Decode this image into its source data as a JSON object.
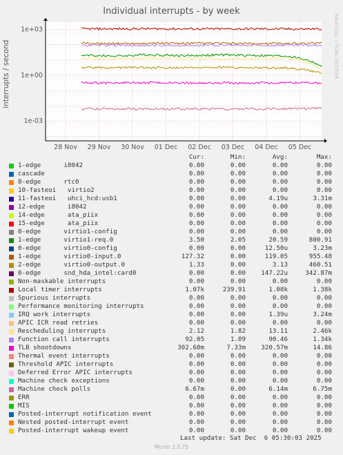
{
  "title": "Individual interrupts - by week",
  "side_brand": "RRDTOOL / TOBI OETIKER",
  "ylabel": "interrupts / second",
  "columns": {
    "cur": "Cur:",
    "min": "Min:",
    "avg": "Avg:",
    "max": "Max:"
  },
  "legend": [
    {
      "name": "1-edge      i8042",
      "color": "#00cc00",
      "cur": "0.00",
      "min": "0.00",
      "avg": "0.00",
      "max": "0.00"
    },
    {
      "name": "cascade",
      "color": "#0066b3",
      "cur": "0.00",
      "min": "0.00",
      "avg": "0.00",
      "max": "0.00"
    },
    {
      "name": "8-edge      rtc0",
      "color": "#ff8000",
      "cur": "0.00",
      "min": "0.00",
      "avg": "0.00",
      "max": "0.00"
    },
    {
      "name": "10-fasteoi   virtio2",
      "color": "#ffcc00",
      "cur": "0.00",
      "min": "0.00",
      "avg": "0.00",
      "max": "0.00"
    },
    {
      "name": "11-fasteoi   uhci_hcd:usb1",
      "color": "#330099",
      "cur": "0.00",
      "min": "0.00",
      "avg": "4.19u",
      "max": "3.31m"
    },
    {
      "name": "12-edge      i8042",
      "color": "#990099",
      "cur": "0.00",
      "min": "0.00",
      "avg": "0.00",
      "max": "0.00"
    },
    {
      "name": "14-edge      ata_piix",
      "color": "#ccff00",
      "cur": "0.00",
      "min": "0.00",
      "avg": "0.00",
      "max": "0.00"
    },
    {
      "name": "15-edge      ata_piix",
      "color": "#ff0000",
      "cur": "0.00",
      "min": "0.00",
      "avg": "0.00",
      "max": "0.00"
    },
    {
      "name": "0-edge      virtio1-config",
      "color": "#808080",
      "cur": "0.00",
      "min": "0.00",
      "avg": "0.00",
      "max": "0.00"
    },
    {
      "name": "1-edge      virtio1-req.0",
      "color": "#008f00",
      "cur": "3.50",
      "min": "2.05",
      "avg": "20.59",
      "max": "800.91"
    },
    {
      "name": "0-edge      virtio0-config",
      "color": "#00487d",
      "cur": "0.00",
      "min": "0.00",
      "avg": "12.50u",
      "max": "3.23m"
    },
    {
      "name": "1-edge      virtio0-input.0",
      "color": "#b35a00",
      "cur": "127.32",
      "min": "0.00",
      "avg": "119.05",
      "max": "955.48"
    },
    {
      "name": "2-edge      virtio0-output.0",
      "color": "#b38f00",
      "cur": "1.33",
      "min": "0.00",
      "avg": "3.13",
      "max": "460.51"
    },
    {
      "name": "0-edge      snd_hda_intel:card0",
      "color": "#6b006b",
      "cur": "0.00",
      "min": "0.00",
      "avg": "147.22u",
      "max": "342.87m"
    },
    {
      "name": "Non-maskable interrupts",
      "color": "#8fb300",
      "cur": "0.00",
      "min": "0.00",
      "avg": "0.00",
      "max": "0.00"
    },
    {
      "name": "Local timer interrupts",
      "color": "#b30000",
      "cur": "1.07k",
      "min": "239.91",
      "avg": "1.08k",
      "max": "1.38k"
    },
    {
      "name": "Spurious interrupts",
      "color": "#bebebe",
      "cur": "0.00",
      "min": "0.00",
      "avg": "0.00",
      "max": "0.00"
    },
    {
      "name": "Performance monitoring interrupts",
      "color": "#80ff80",
      "cur": "0.00",
      "min": "0.00",
      "avg": "0.00",
      "max": "0.00"
    },
    {
      "name": "IRQ work interrupts",
      "color": "#80c9ff",
      "cur": "0.00",
      "min": "0.00",
      "avg": "1.39u",
      "max": "3.24m"
    },
    {
      "name": "APIC ICR read retries",
      "color": "#ffc080",
      "cur": "0.00",
      "min": "0.00",
      "avg": "0.00",
      "max": "0.00"
    },
    {
      "name": "Rescheduling interrupts",
      "color": "#ffe680",
      "cur": "2.12",
      "min": "1.82",
      "avg": "13.11",
      "max": "2.46k"
    },
    {
      "name": "Function call interrupts",
      "color": "#aa80ff",
      "cur": "92.05",
      "min": "1.09",
      "avg": "90.46",
      "max": "1.34k"
    },
    {
      "name": "TLB shootdowns",
      "color": "#ee00cc",
      "cur": "302.68m",
      "min": "7.33m",
      "avg": "320.57m",
      "max": "14.86"
    },
    {
      "name": "Thermal event interrupts",
      "color": "#ff8080",
      "cur": "0.00",
      "min": "0.00",
      "avg": "0.00",
      "max": "0.00"
    },
    {
      "name": "Threshold APIC interrupts",
      "color": "#666600",
      "cur": "0.00",
      "min": "0.00",
      "avg": "0.00",
      "max": "0.00"
    },
    {
      "name": "Deferred Error APIC interrupts",
      "color": "#ffbfff",
      "cur": "0.00",
      "min": "0.00",
      "avg": "0.00",
      "max": "0.00"
    },
    {
      "name": "Machine check exceptions",
      "color": "#00ffcc",
      "cur": "0.00",
      "min": "0.00",
      "avg": "0.00",
      "max": "0.00"
    },
    {
      "name": "Machine check polls",
      "color": "#cc6699",
      "cur": "6.67m",
      "min": "0.00",
      "avg": "6.14m",
      "max": "6.75m"
    },
    {
      "name": "ERR",
      "color": "#999900",
      "cur": "0.00",
      "min": "0.00",
      "avg": "0.00",
      "max": "0.00"
    },
    {
      "name": "MIS",
      "color": "#00cc00",
      "cur": "0.00",
      "min": "0.00",
      "avg": "0.00",
      "max": "0.00"
    },
    {
      "name": "Posted-interrupt notification event",
      "color": "#0066b3",
      "cur": "0.00",
      "min": "0.00",
      "avg": "0.00",
      "max": "0.00"
    },
    {
      "name": "Nested posted-interrupt event",
      "color": "#ff8000",
      "cur": "0.00",
      "min": "0.00",
      "avg": "0.00",
      "max": "0.00"
    },
    {
      "name": "Posted-interrupt wakeup event",
      "color": "#ffcc00",
      "cur": "0.00",
      "min": "0.00",
      "avg": "0.00",
      "max": "0.00"
    }
  ],
  "last_update": "Last update: Sat Dec  6 05:30:03 2025",
  "version": "Munin 2.0.75",
  "chart_data": {
    "type": "line",
    "title": "Individual interrupts - by week",
    "ylabel": "interrupts / second",
    "yscale": "log",
    "ylim": [
      5e-05,
      3000
    ],
    "y_ticks": [
      {
        "value": 1000,
        "label": "1e+03"
      },
      {
        "value": 1,
        "label": "1e+00"
      },
      {
        "value": 0.001,
        "label": "1e-03"
      }
    ],
    "x_ticks": [
      "28 Nov",
      "29 Nov",
      "30 Nov",
      "01 Dec",
      "02 Dec",
      "03 Dec",
      "04 Dec",
      "05 Dec"
    ],
    "grid": true,
    "series": [
      {
        "name": "Local timer interrupts",
        "color": "#b30000",
        "values": [
          1070,
          1080,
          1100,
          1090,
          1070,
          1080,
          1060,
          1070
        ]
      },
      {
        "name": "1-edge      virtio0-input.0",
        "color": "#b35a00",
        "values": [
          120,
          118,
          125,
          119,
          122,
          115,
          120,
          127
        ]
      },
      {
        "name": "Function call interrupts",
        "color": "#aa80ff",
        "values": [
          90,
          92,
          88,
          91,
          90,
          89,
          92,
          92
        ]
      },
      {
        "name": "1-edge      virtio1-req.0",
        "color": "#008f00",
        "values": [
          20,
          18,
          22,
          19,
          21,
          20,
          18,
          3.5
        ]
      },
      {
        "name": "Rescheduling interrupts",
        "color": "#ffe680",
        "values": [
          13,
          12,
          14,
          13,
          12,
          13,
          14,
          2.1
        ]
      },
      {
        "name": "2-edge      virtio0-output.0",
        "color": "#b38f00",
        "values": [
          3,
          3.2,
          3.1,
          3,
          3.3,
          3.1,
          3,
          1.33
        ]
      },
      {
        "name": "TLB shootdowns",
        "color": "#ee00cc",
        "values": [
          0.32,
          0.3,
          0.33,
          0.31,
          0.32,
          0.3,
          0.33,
          0.3
        ]
      },
      {
        "name": "Machine check polls",
        "color": "#cc6699",
        "values": [
          0.0061,
          0.0062,
          0.0061,
          0.0062,
          0.0061,
          0.0062,
          0.0061,
          0.0067
        ]
      }
    ]
  }
}
